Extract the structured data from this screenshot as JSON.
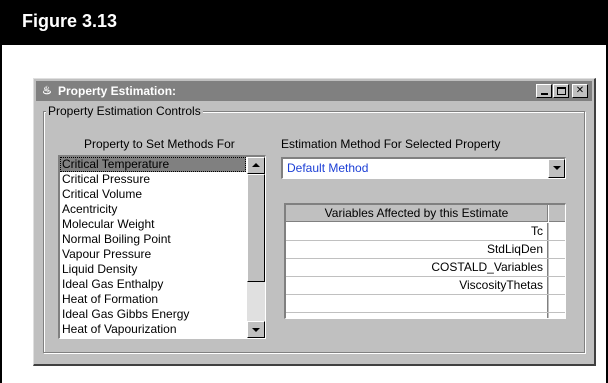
{
  "figure": {
    "label": "Figure 3.13"
  },
  "window": {
    "title": "Property Estimation:",
    "controls": {
      "minimize": "_",
      "maximize": "□",
      "close": "✕"
    }
  },
  "group": {
    "label": "Property Estimation Controls"
  },
  "property_list": {
    "label": "Property to Set Methods For",
    "items": [
      "Critical Temperature",
      "Critical Pressure",
      "Critical Volume",
      "Acentricity",
      "Molecular Weight",
      "Normal Boiling Point",
      "Vapour Pressure",
      "Liquid Density",
      "Ideal Gas Enthalpy",
      "Heat of Formation",
      "Ideal Gas Gibbs Energy",
      "Heat of Vapourization"
    ],
    "selected_index": 0
  },
  "method": {
    "label": "Estimation Method For Selected Property",
    "value": "Default Method"
  },
  "variables_grid": {
    "header": "Variables Affected by this Estimate",
    "rows": [
      "Tc",
      "StdLiqDen",
      "COSTALD_Variables",
      "ViscosityThetas",
      "",
      ""
    ]
  },
  "colors": {
    "selection": "#808080",
    "combo_text": "#1c3fd6",
    "face": "#c0c0c0"
  },
  "icons": [
    "window-menu-icon",
    "minimize-icon",
    "maximize-icon",
    "close-icon",
    "scroll-up-arrow-icon",
    "scroll-down-arrow-icon",
    "dropdown-arrow-icon"
  ]
}
